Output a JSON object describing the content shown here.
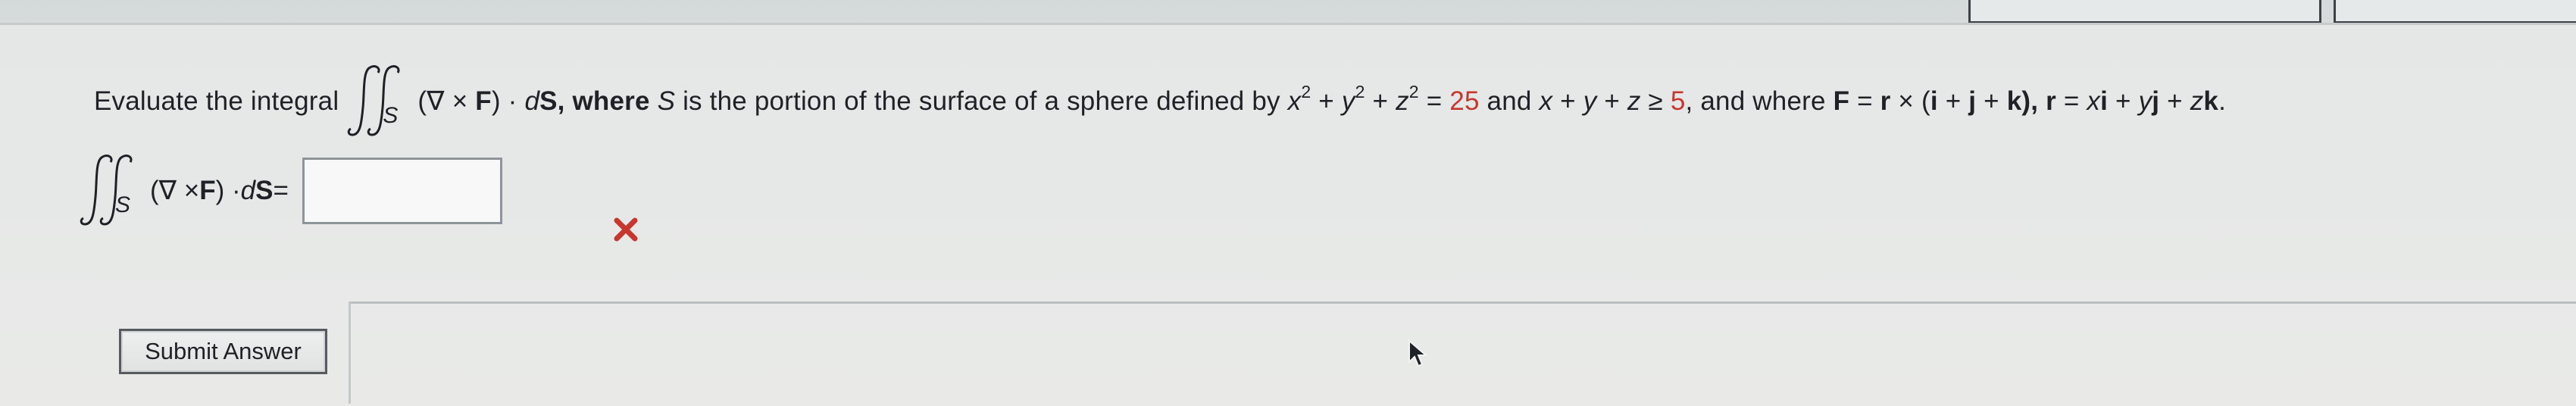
{
  "question": {
    "lead": "Evaluate the integral",
    "integral_sub": "S",
    "integrand_prefix": "(∇ × ",
    "integrand_F": "F",
    "integrand_mid": ") · ",
    "integrand_d": "d",
    "integrand_S": "S",
    "after_integrand": ", where ",
    "surface_var": "S",
    "sentence": " is the portion of the surface of a sphere defined by ",
    "x": "x",
    "y": "y",
    "z": "z",
    "exp": "2",
    "plus": " + ",
    "equals": " = ",
    "radius_sq": "25",
    "and": " and ",
    "plane_lhs_x": "x",
    "plane_lhs_y": "y",
    "plane_lhs_z": "z",
    "geq": " ≥ ",
    "plane_rhs": "5",
    "where": ", and where ",
    "F": "F",
    "r": "r",
    "cross": " × (",
    "i": "i",
    "j": "j",
    "k": "k",
    "close_comma": "), ",
    "r_def_eq": " = ",
    "xi_x": "x",
    "xi_i": "i",
    "yj_y": "y",
    "yj_j": "j",
    "zk_z": "z",
    "zk_k": "k",
    "period": "."
  },
  "answer": {
    "integral_sub": "S",
    "prefix": "(∇ × ",
    "F": "F",
    "mid": ") · ",
    "d": "d",
    "S": "S",
    "equals": " =",
    "value": "",
    "status": "incorrect"
  },
  "submit": {
    "label": "Submit Answer"
  },
  "colors": {
    "accent_red": "#c8372d",
    "text": "#1e2226"
  },
  "icons": {
    "status": "x-mark-icon",
    "cursor": "mouse-pointer-icon"
  }
}
